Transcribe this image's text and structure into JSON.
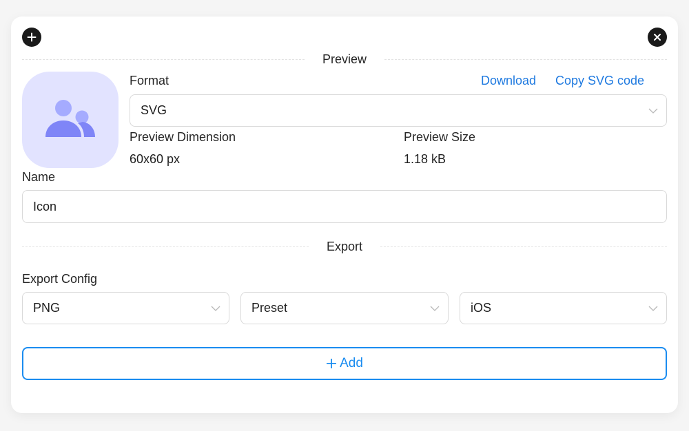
{
  "header": {
    "add_icon": "plus-icon",
    "close_icon": "close-icon"
  },
  "preview": {
    "section_title": "Preview",
    "thumbnail_icon": "users-icon",
    "colors": {
      "thumb_bg": "#e2e3ff",
      "icon_main": "#7f85f7",
      "icon_light": "#a5abff"
    },
    "format_label": "Format",
    "format_value": "SVG",
    "download_label": "Download",
    "copy_label": "Copy SVG code",
    "dimension_label": "Preview Dimension",
    "dimension_value": "60x60 px",
    "size_label": "Preview Size",
    "size_value": "1.18 kB"
  },
  "name": {
    "label": "Name",
    "value": "Icon"
  },
  "export": {
    "section_title": "Export",
    "config_label": "Export Config",
    "selects": [
      {
        "value": "PNG"
      },
      {
        "value": "Preset"
      },
      {
        "value": "iOS"
      }
    ],
    "add_label": "Add",
    "accent_color": "#1a8cf0"
  }
}
